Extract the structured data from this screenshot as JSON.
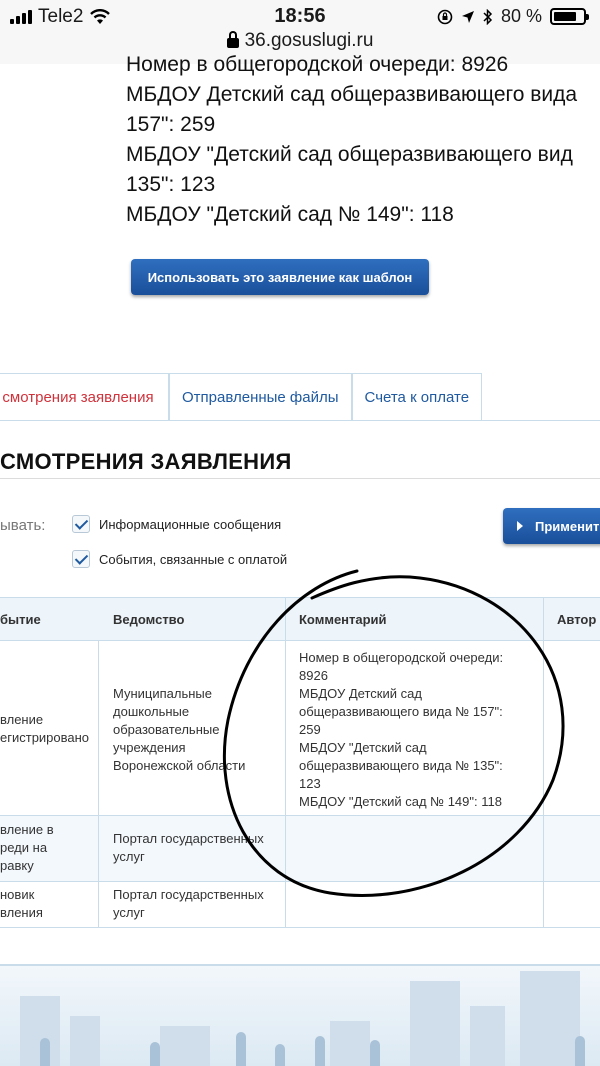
{
  "status_bar": {
    "carrier": "Tele2",
    "time": "18:56",
    "battery": "80 %",
    "battery_level": 0.8,
    "url": "36.gosuslugi.ru"
  },
  "top_comment": {
    "lines": [
      "Номер в общегородской очереди: 8926",
      "МБДОУ Детский сад общеразвивающего вида",
      "157\": 259",
      "МБДОУ \"Детский сад общеразвивающего вид",
      "135\": 123",
      "МБДОУ \"Детский сад № 149\": 118"
    ]
  },
  "template_button": {
    "label": "Использовать это заявление как шаблон"
  },
  "tabs": [
    {
      "label": "смотрения заявления",
      "active": true
    },
    {
      "label": "Отправленные файлы",
      "active": false
    },
    {
      "label": "Счета к оплате",
      "active": false
    }
  ],
  "section_title": "СМОТРЕНИЯ ЗАЯВЛЕНИЯ",
  "filter": {
    "label": "ывать:",
    "options": [
      {
        "label": "Информационные сообщения",
        "checked": true
      },
      {
        "label": "События, связанные с оплатой",
        "checked": true
      }
    ],
    "apply_label": "Применит"
  },
  "table": {
    "headers": [
      "бытие",
      "Ведомство",
      "Комментарий",
      "Автор"
    ],
    "rows": [
      {
        "event": [
          "вление",
          "егистрировано"
        ],
        "agency": [
          "Муниципальные",
          "дошкольные",
          "образовательные",
          "учреждения",
          "Воронежской области"
        ],
        "comment": [
          "Номер в общегородской очереди:",
          "8926",
          "МБДОУ Детский сад",
          "общеразвивающего вида № 157\":",
          "259",
          "МБДОУ \"Детский сад",
          "общеразвивающего вида № 135\":",
          "123",
          "МБДОУ \"Детский сад № 149\": 118"
        ]
      },
      {
        "event": [
          "вление в",
          "реди на",
          "равку"
        ],
        "agency": [
          "Портал государственных",
          "услуг"
        ],
        "comment": []
      },
      {
        "event": [
          "новик",
          "вления"
        ],
        "agency": [
          "Портал государственных",
          "услуг"
        ],
        "comment": []
      }
    ]
  },
  "colors": {
    "button": "#1a4f9a",
    "active_tab": "#d0323b",
    "link": "#1f5aa0",
    "table_header_bg": "#edf4fa",
    "border": "#c9dcea"
  }
}
